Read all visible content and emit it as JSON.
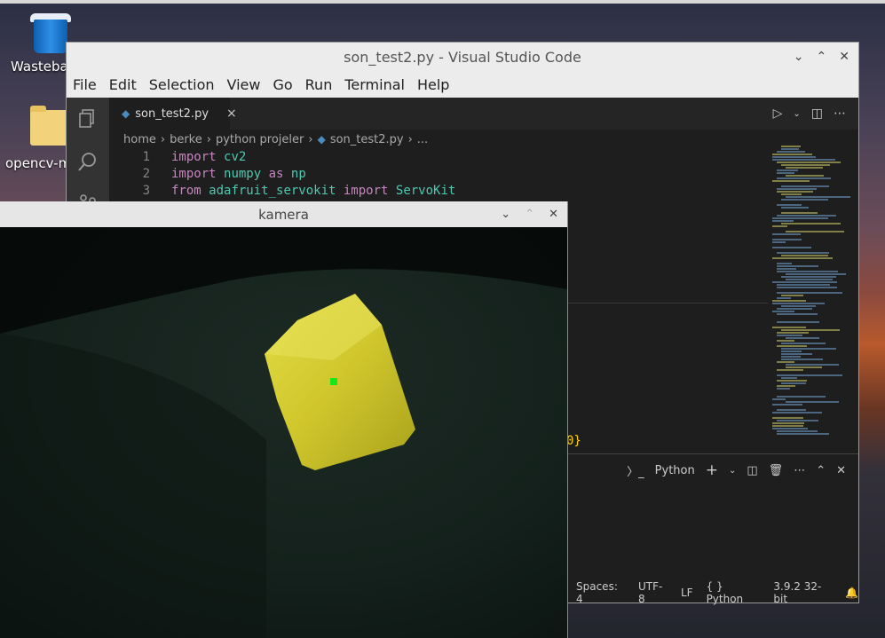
{
  "desktop": {
    "icons": [
      {
        "label": "Wastebasket",
        "visible_label": "Wasteba"
      },
      {
        "label": "opencv-m",
        "visible_label": "opencv-m"
      }
    ]
  },
  "vscode": {
    "title": "son_test2.py - Visual Studio Code",
    "menu": [
      "File",
      "Edit",
      "Selection",
      "View",
      "Go",
      "Run",
      "Terminal",
      "Help"
    ],
    "tab": {
      "label": "son_test2.py",
      "close": "×"
    },
    "breadcrumb": [
      "home",
      "berke",
      "python projeler",
      "son_test2.py",
      "..."
    ],
    "code_lines": [
      {
        "num": "1",
        "tokens": [
          [
            "kw",
            "import "
          ],
          [
            "mod",
            "cv2"
          ]
        ]
      },
      {
        "num": "2",
        "tokens": [
          [
            "kw",
            "import "
          ],
          [
            "mod",
            "numpy "
          ],
          [
            "kw",
            "as "
          ],
          [
            "mod",
            "np"
          ]
        ]
      },
      {
        "num": "3",
        "tokens": [
          [
            "kw",
            "from "
          ],
          [
            "mod",
            "adafruit_servokit "
          ],
          [
            "kw",
            "import "
          ],
          [
            "mod",
            "ServoKit"
          ]
        ]
      }
    ],
    "partial_code_fragment": "0}",
    "panel": {
      "terminal_label": "Python"
    },
    "status": {
      "spaces": "Spaces: 4",
      "encoding": "UTF-8",
      "eol": "LF",
      "language": "Python",
      "interpreter": "3.9.2 32-bit"
    }
  },
  "kamera": {
    "title": "kamera"
  },
  "colors": {
    "keyword": "#c586c0",
    "module": "#4ec9b0",
    "object": "#d6d234",
    "marker": "#19e619"
  }
}
